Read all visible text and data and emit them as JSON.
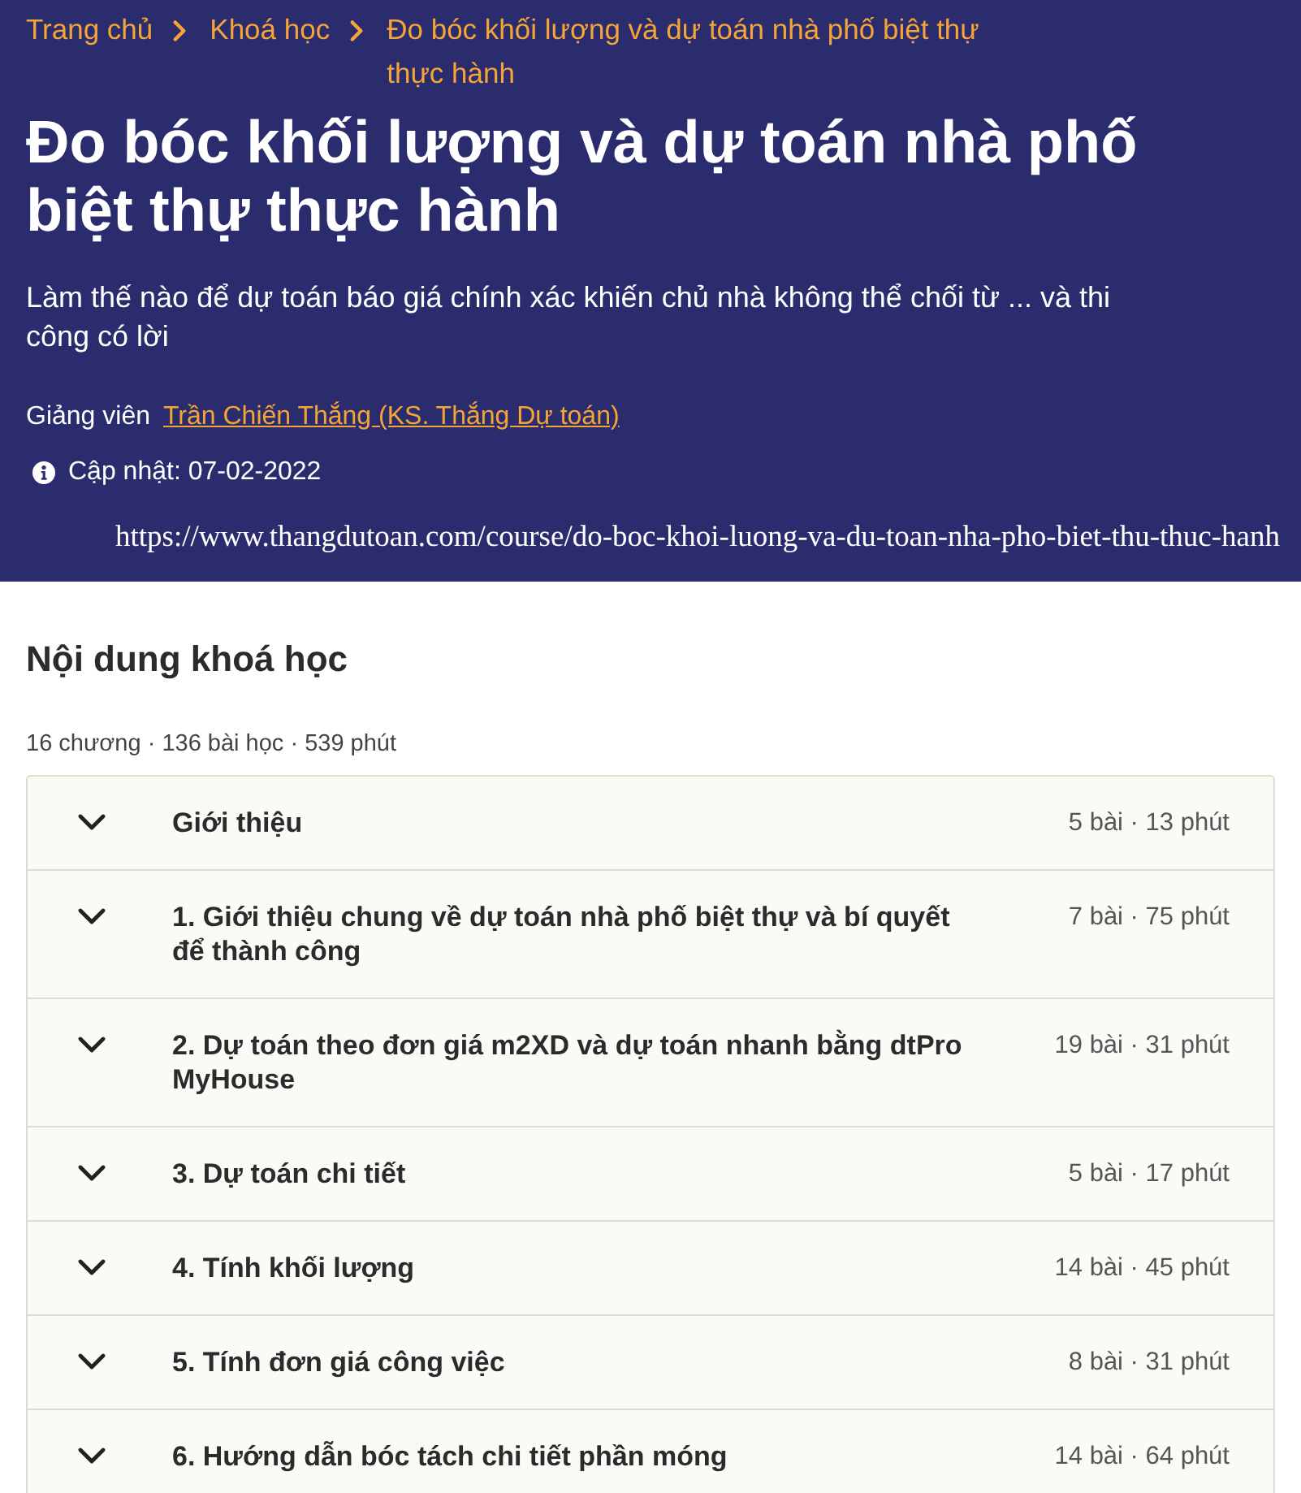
{
  "breadcrumb": [
    {
      "label": "Trang chủ"
    },
    {
      "label": "Khoá học"
    },
    {
      "label": "Đo bóc khối lượng và dự toán nhà phố biệt thự thực hành"
    }
  ],
  "course": {
    "title": "Đo bóc khối lượng và dự toán nhà phố biệt thự thực hành",
    "subtitle": "Làm thế nào để dự toán báo giá chính xác khiến chủ nhà không thể chối từ ... và thi công có lời",
    "instructor_label": "Giảng viên",
    "instructor": "Trần Chiến Thắng (KS. Thắng Dự toán)",
    "updated": "Cập nhật: 07-02-2022"
  },
  "source_url": "https://www.thangdutoan.com/course/do-boc-khoi-luong-va-du-toan-nha-pho-biet-thu-thuc-hanh",
  "content": {
    "heading": "Nội dung khoá học",
    "summary": "16 chương · 136 bài học · 539 phút",
    "chapters": [
      {
        "title": "Giới thiệu",
        "meta": "5 bài · 13 phút",
        "expanded": false
      },
      {
        "title": "1. Giới thiệu chung về dự toán nhà phố biệt thự và bí quyết để thành công",
        "meta": "7 bài · 75 phút",
        "expanded": false
      },
      {
        "title": "2. Dự toán theo đơn giá m2XD và dự toán nhanh bằng dtPro MyHouse",
        "meta": "19 bài · 31 phút",
        "expanded": false
      },
      {
        "title": "3. Dự toán chi tiết",
        "meta": "5 bài · 17 phút",
        "expanded": false
      },
      {
        "title": "4. Tính khối lượng",
        "meta": "14 bài · 45 phút",
        "expanded": false
      },
      {
        "title": "5. Tính đơn giá công việc",
        "meta": "8 bài · 31 phút",
        "expanded": false
      },
      {
        "title": "6. Hướng dẫn bóc tách chi tiết phần móng",
        "meta": "14 bài · 64 phút",
        "expanded": false
      }
    ]
  }
}
